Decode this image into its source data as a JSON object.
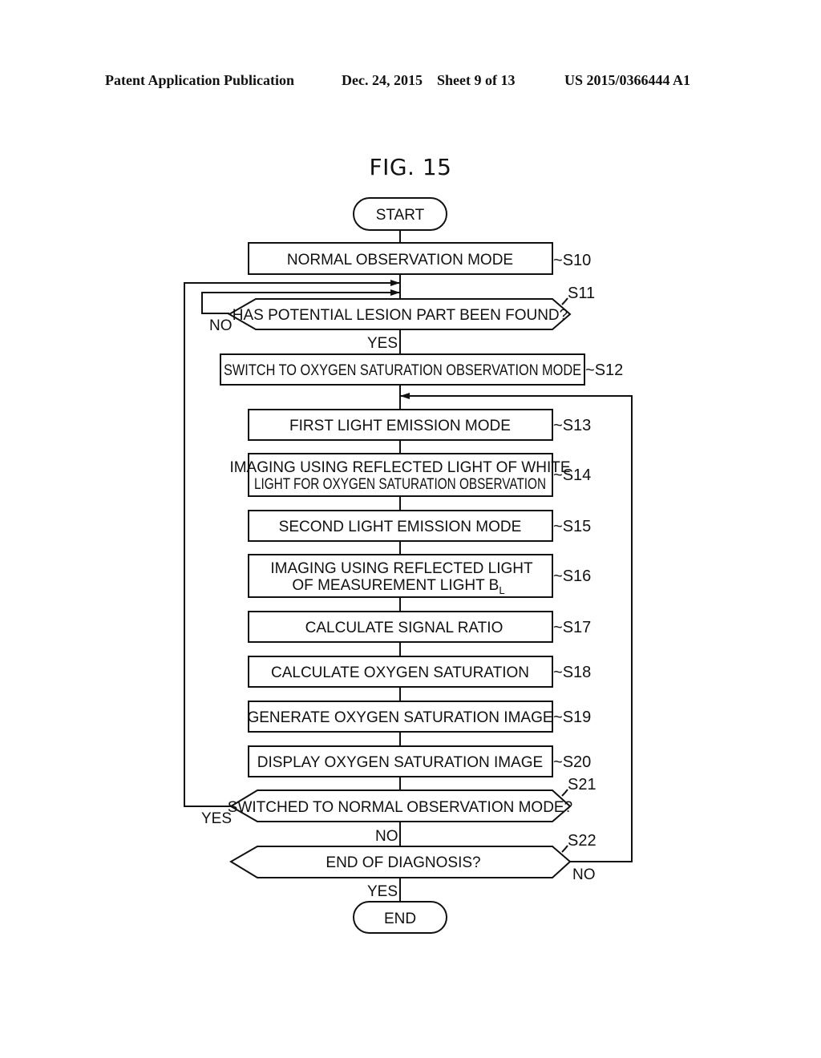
{
  "header": {
    "publication": "Patent Application Publication",
    "date": "Dec. 24, 2015",
    "sheet": "Sheet 9 of 13",
    "number": "US 2015/0366444 A1"
  },
  "figure": {
    "title": "FIG. 15"
  },
  "flowchart": {
    "start": "START",
    "end": "END",
    "steps": {
      "s10": {
        "id": "S10",
        "text": [
          "NORMAL OBSERVATION MODE"
        ]
      },
      "s11": {
        "id": "S11",
        "text": [
          "HAS POTENTIAL LESION PART BEEN FOUND?"
        ],
        "yes": "YES",
        "no": "NO"
      },
      "s12": {
        "id": "S12",
        "text": [
          "SWITCH TO OXYGEN SATURATION OBSERVATION MODE"
        ]
      },
      "s13": {
        "id": "S13",
        "text": [
          "FIRST LIGHT EMISSION MODE"
        ]
      },
      "s14": {
        "id": "S14",
        "text": [
          "IMAGING USING REFLECTED LIGHT OF WHITE",
          "LIGHT FOR OXYGEN SATURATION OBSERVATION"
        ]
      },
      "s15": {
        "id": "S15",
        "text": [
          "SECOND LIGHT EMISSION MODE"
        ]
      },
      "s16": {
        "id": "S16",
        "text": [
          "IMAGING USING REFLECTED LIGHT",
          "OF MEASUREMENT LIGHT B"
        ],
        "subscript": "L"
      },
      "s17": {
        "id": "S17",
        "text": [
          "CALCULATE SIGNAL RATIO"
        ]
      },
      "s18": {
        "id": "S18",
        "text": [
          "CALCULATE OXYGEN SATURATION"
        ]
      },
      "s19": {
        "id": "S19",
        "text": [
          "GENERATE OXYGEN SATURATION IMAGE"
        ]
      },
      "s20": {
        "id": "S20",
        "text": [
          "DISPLAY OXYGEN SATURATION IMAGE"
        ]
      },
      "s21": {
        "id": "S21",
        "text": [
          "SWITCHED TO NORMAL OBSERVATION MODE?"
        ],
        "yes": "YES",
        "no": "NO"
      },
      "s22": {
        "id": "S22",
        "text": [
          "END OF DIAGNOSIS?"
        ],
        "yes": "YES",
        "no": "NO"
      }
    }
  }
}
